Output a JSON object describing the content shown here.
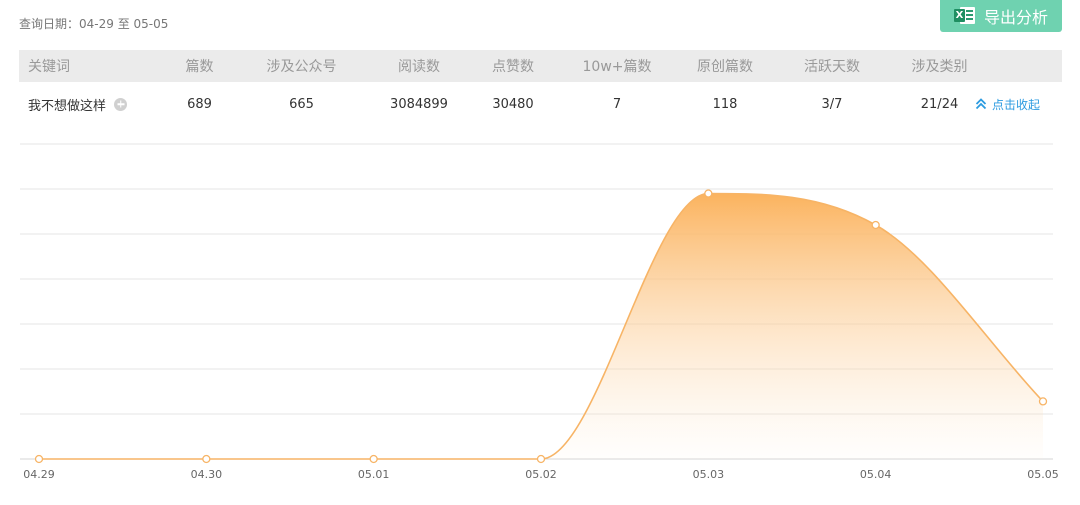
{
  "query": {
    "label": "查询日期：",
    "range": "04-29 至 05-05"
  },
  "export_button": {
    "label": "导出分析",
    "icon": "excel-icon",
    "color": "#6fd2b0"
  },
  "table": {
    "headers": [
      "关键词",
      "篇数",
      "涉及公众号",
      "阅读数",
      "点赞数",
      "10w+篇数",
      "原创篇数",
      "活跃天数",
      "涉及类别"
    ],
    "row": {
      "keyword": "我不想做这样",
      "articles": "689",
      "accounts": "665",
      "reads": "3084899",
      "likes": "30480",
      "over_100k": "7",
      "original": "118",
      "active_days": "3/7",
      "categories": "21/24",
      "collapse_label": "点击收起"
    }
  },
  "chart_data": {
    "type": "area",
    "categories": [
      "04.29",
      "04.30",
      "05.01",
      "05.02",
      "05.03",
      "05.04",
      "05.05"
    ],
    "values": [
      0,
      0,
      0,
      0,
      590,
      520,
      128
    ],
    "ylim": [
      0,
      700
    ],
    "grid": true,
    "color": "#f9b45a"
  }
}
